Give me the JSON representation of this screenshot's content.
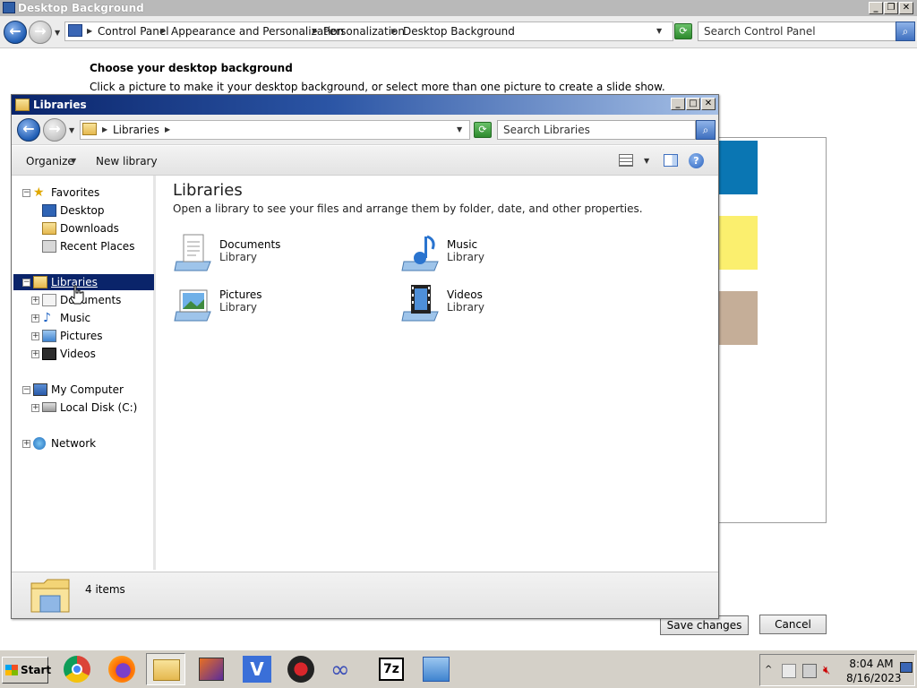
{
  "background_window": {
    "title": "Desktop Background",
    "breadcrumb": [
      "Control Panel",
      "Appearance and Personalization",
      "Personalization",
      "Desktop Background"
    ],
    "search_placeholder": "Search Control Panel",
    "heading": "Choose your desktop background",
    "description": "Click a picture to make it your desktop background, or select more than one picture to create a slide show.",
    "swatch_colors": [
      "#0a76b3",
      "#fbef6e",
      "#c5ae98"
    ],
    "save_label": "Save changes",
    "cancel_label": "Cancel"
  },
  "libraries_window": {
    "title": "Libraries",
    "breadcrumb": [
      "Libraries"
    ],
    "search_placeholder": "Search Libraries",
    "toolbar": {
      "organize_label": "Organize",
      "new_library_label": "New library"
    },
    "nav": {
      "favorites_label": "Favorites",
      "favorites_items": [
        "Desktop",
        "Downloads",
        "Recent Places"
      ],
      "libraries_label": "Libraries",
      "libraries_items": [
        "Documents",
        "Music",
        "Pictures",
        "Videos"
      ],
      "computer_label": "My Computer",
      "computer_items": [
        "Local Disk (C:)"
      ],
      "network_label": "Network"
    },
    "content": {
      "heading": "Libraries",
      "subtext": "Open a library to see your files and arrange them by folder, date, and other properties.",
      "items": [
        {
          "name": "Documents",
          "type": "Library",
          "icon": "documents-library-icon"
        },
        {
          "name": "Music",
          "type": "Library",
          "icon": "music-library-icon"
        },
        {
          "name": "Pictures",
          "type": "Library",
          "icon": "pictures-library-icon"
        },
        {
          "name": "Videos",
          "type": "Library",
          "icon": "videos-library-icon"
        }
      ]
    },
    "details": {
      "count_text": "4 items"
    }
  },
  "taskbar": {
    "start_label": "Start",
    "apps": [
      "chrome-icon",
      "firefox-icon",
      "explorer-icon",
      "paint-icon",
      "v-app-icon",
      "obs-icon",
      "infinity-icon",
      "7zip-icon",
      "control-panel-icon"
    ],
    "seven_zip_label": "7z",
    "v_label": "V",
    "time": "8:04 AM",
    "date": "8/16/2023"
  }
}
